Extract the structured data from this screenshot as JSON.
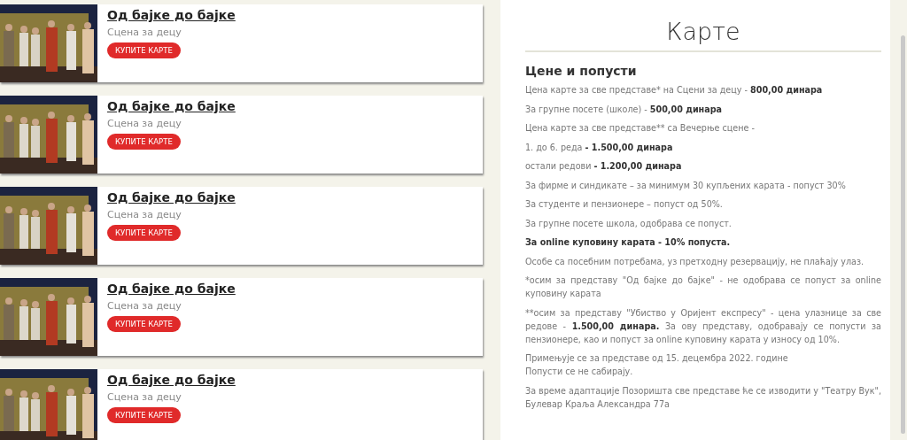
{
  "shows": [
    {
      "title": "Од бајке до бајке",
      "stage": "Сцена за децу",
      "button": "КУПИТЕ КАРТЕ"
    },
    {
      "title": "Од бајке до бајке",
      "stage": "Сцена за децу",
      "button": "КУПИТЕ КАРТЕ"
    },
    {
      "title": "Од бајке до бајке",
      "stage": "Сцена за децу",
      "button": "КУПИТЕ КАРТЕ"
    },
    {
      "title": "Од бајке до бајке",
      "stage": "Сцена за децу",
      "button": "КУПИТЕ КАРТЕ"
    },
    {
      "title": "Од бајке до бајке",
      "stage": "Сцена за децу",
      "button": "КУПИТЕ КАРТЕ"
    }
  ],
  "tickets": {
    "title": "Карте",
    "subtitle": "Цене и попусти",
    "paragraphs": [
      {
        "kind": "text",
        "lines": [
          "Цена карте за све представе* на Сцени за децу - **800,00 динара**"
        ]
      },
      {
        "kind": "text",
        "lines": [
          "За групне посете (школе) - **500,00 динара**"
        ]
      },
      {
        "kind": "text",
        "lines": [
          "Цена карте за све представе** са Вечерње сцене -"
        ]
      },
      {
        "kind": "text",
        "lines": [
          "1. до 6. реда **- 1.500,00 динара**"
        ]
      },
      {
        "kind": "text",
        "lines": [
          "остали редови **- 1.200,00 динара**"
        ]
      },
      {
        "kind": "text",
        "lines": [
          "За фирме и синдикате – за минимум 30 купљених карата - попуст 30%"
        ]
      },
      {
        "kind": "text",
        "lines": [
          "За студенте и пензионере – попуст од 50%."
        ]
      },
      {
        "kind": "text",
        "lines": [
          "За групне посете школа, одобрава се попуст."
        ]
      },
      {
        "kind": "bold",
        "lines": [
          "За online куповину карата - 10% попуста."
        ]
      },
      {
        "kind": "text",
        "lines": [
          "Особе са посебним потребама, уз претходну резервацију, не плаћају улаз."
        ]
      },
      {
        "kind": "text",
        "lines": [
          "*осим за представу \"Од бајке до бајке\" - не одобрава се попуст за online куповину карата"
        ]
      },
      {
        "kind": "text",
        "prefix": "**",
        "lines": [
          "осим за представу \"Убиство у Оријент експресу\" - цена улазнице за све редове - **1.500,00 динара.** За ову представу, одобравају се попусти за пензионере, као и попуст за online куповину карата у износу од 10%."
        ]
      },
      {
        "kind": "text",
        "lines": [
          "Примењује се за представе од 15. децембра 2022. године",
          "Попусти се не сабирају."
        ]
      },
      {
        "kind": "text",
        "lines": [
          "За време адаптације Позоришта све представе ће се изводити у \"Театру Вук\", Булевар Краља Александра 77а"
        ]
      }
    ]
  }
}
